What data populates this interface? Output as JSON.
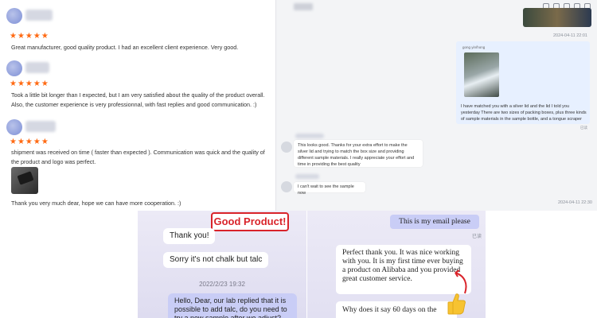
{
  "reviews": [
    {
      "stars": "★★★★★",
      "text": "Great manufacturer, good quality product. I had an excellent client experience. Very good."
    },
    {
      "stars": "★★★★★",
      "text": "Took a little bit longer than I expected, but I am very satisfied about the quality of the product overall. Also, the customer experience is very professionnal, with fast replies and good communication. :)"
    },
    {
      "stars": "★★★★★",
      "text": "shipment was received on time ( faster than expected ). Communication was quick and the quality of the product and logo was perfect."
    }
  ],
  "review_reply": "Thank you very much dear, hope we can have more cooperation. :)",
  "chat": {
    "timestamp_1": "2024-04-11 22:01",
    "out_label": "gong yin/hong",
    "out_text": "I have matched you with a silver lid and the lid I told you yesterday There are two sizes of packing boxes, plus three kinds of sample materials in the sample bottle, and a tongue scraper",
    "out_read": "已读",
    "in_text_1": "This looks good. Thanks for your extra effort to make the silver lid and trying to match the box size and providing different sample materials. I really appreciate your effort and time in providing the best quality",
    "in_text_2": "I can't wait to see the sample now",
    "timestamp_2": "2024-04-11 22:30"
  },
  "mobile1": {
    "badge": "Good Product!",
    "msg1": "Thank you!",
    "msg2": "Sorry it's not chalk but talc",
    "timestamp": "2022/2/23 19:32",
    "msg3": "Hello, Dear, our lab replied that it is possible to add talc, do you need to try a new sample after we adjust?"
  },
  "mobile2": {
    "msg_out": "This is my email please",
    "read": "已读",
    "msg_in1": "Perfect thank you. It was nice working with you. It is my first time ever buying a product on Alibaba and you provided great customer service.",
    "msg_in2": "Why does it say 60 days on the"
  },
  "colors": {
    "star": "#ff6a13",
    "badge_red": "#d9232a",
    "bubble_purple": "#c9cdf6",
    "bubble_blue": "#e7f0ff"
  }
}
